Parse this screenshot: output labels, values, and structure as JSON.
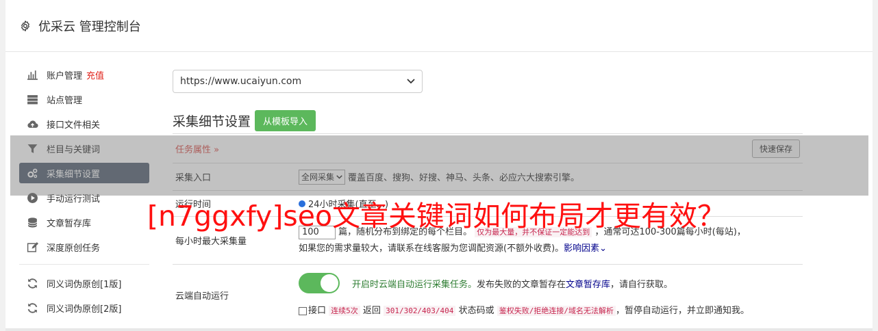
{
  "header": {
    "title": "优采云 管理控制台",
    "icon": "gear-icon"
  },
  "sidebar": {
    "items": [
      {
        "label": "账户管理",
        "tag": "充值",
        "icon": "bar-chart-icon"
      },
      {
        "label": "站点管理",
        "icon": "server-icon"
      },
      {
        "label": "接口文件相关",
        "icon": "cloud-upload-icon"
      },
      {
        "label": "栏目与关键词",
        "icon": "filter-icon"
      },
      {
        "label": "采集细节设置",
        "icon": "gears-icon",
        "active": true
      },
      {
        "label": "手动运行测试",
        "icon": "play-circle-icon"
      },
      {
        "label": "文章暂存库",
        "icon": "database-icon"
      },
      {
        "label": "深度原创任务",
        "icon": "edit-icon"
      },
      {
        "label": "同义词伪原创[1版]",
        "icon": "refresh-icon"
      },
      {
        "label": "同义词伪原创[2版]",
        "icon": "refresh-icon"
      }
    ]
  },
  "main": {
    "site_select": "https://www.ucaiyun.com",
    "section_title": "采集细节设置",
    "import_button": "从模板导入",
    "task_attr": "任务属性",
    "task_attr_chevron": "»",
    "quick_save": "快速保存",
    "rows": {
      "entry": {
        "label": "采集入口",
        "select": "全网采集",
        "desc": "覆盖百度、搜狗、好搜、神马、头条、必应六大搜索引擎。"
      },
      "runtime": {
        "label": "运行时间",
        "text": "24小时采集(直至...)"
      },
      "max_per_hour": {
        "label": "每小时最大采集量",
        "value": "100",
        "text1": "篇，随机分布到绑定的每个栏目。",
        "code1": "仅为最大量，并不保证一定能达到",
        "text2": "，通常可达100-300篇每小时(每站)，",
        "text3": "如果您的需求量较大，请联系在线客服为您调配资源(不额外收费)。",
        "link": "影响因素"
      },
      "cloud_run": {
        "label": "云端自动运行",
        "status": "开启时云端自动运行采集任务。",
        "text1": "发布失败的文章暂存在",
        "link": "文章暂存库",
        "text2": "，请自行获取。",
        "check_text": "接口",
        "code1": "连续5次",
        "text3": "返回",
        "code2": "301/302/403/404",
        "text4": "状态码或",
        "code3": "鉴权失败/拒绝连接/域名无法解析",
        "text5": "，暂停自动运行，并立即通知我。"
      }
    }
  },
  "overlay": {
    "text": "[n7ggxfy]seo文章关键词如何布局才更有效？"
  },
  "colors": {
    "active_bg": "#5a6677",
    "accent_green": "#5cb85c",
    "red": "#e0221a",
    "overlay_text": "#ff1010"
  }
}
